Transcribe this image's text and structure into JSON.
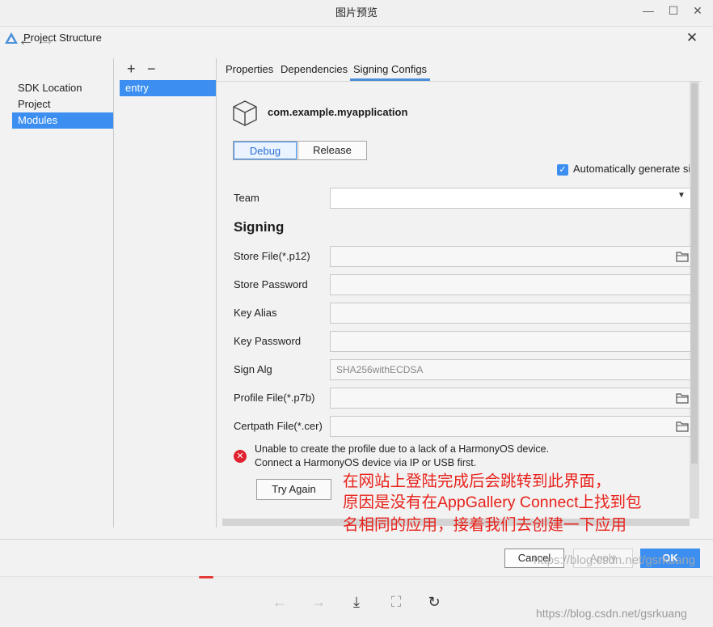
{
  "viewer": {
    "title": "图片预览",
    "controls": {
      "minimize": "—",
      "maximize": "☐",
      "close": "✕"
    },
    "toolbar": {
      "prev": "←",
      "next": "→",
      "download": "⤓",
      "fit": "⛶",
      "rotate": "↻"
    },
    "watermark": "https://blog.csdn.net/gsrkuang"
  },
  "dialog": {
    "title": "Project Structure",
    "close": "✕",
    "nav": {
      "back": "←",
      "forward": "→",
      "items": [
        "SDK Location",
        "Project",
        "Modules"
      ],
      "selected": "Modules"
    },
    "modules": {
      "add": "+",
      "remove": "−",
      "items": [
        "entry"
      ]
    },
    "tabs": [
      "Properties",
      "Dependencies",
      "Signing Configs"
    ],
    "active_tab": "Signing Configs",
    "module_name": "com.example.myapplication",
    "build_types": [
      "Debug",
      "Release"
    ],
    "selected_build_type": "Debug",
    "auto_generate": {
      "label": "Automatically generate si",
      "checked": true
    },
    "team": {
      "label": "Team",
      "value": ""
    },
    "signing_heading": "Signing",
    "fields": {
      "store_file": {
        "label": "Store File(*.p12)",
        "value": ""
      },
      "store_password": {
        "label": "Store Password",
        "value": ""
      },
      "key_alias": {
        "label": "Key Alias",
        "value": ""
      },
      "key_password": {
        "label": "Key Password",
        "value": ""
      },
      "sign_alg": {
        "label": "Sign Alg",
        "value": "SHA256withECDSA"
      },
      "profile_file": {
        "label": "Profile File(*.p7b)",
        "value": ""
      },
      "certpath_file": {
        "label": "Certpath File(*.cer)",
        "value": ""
      }
    },
    "error": {
      "line1": "Unable to create the profile due to a lack of a HarmonyOS device.",
      "line2": "Connect a HarmonyOS device via IP or USB first.",
      "retry": "Try Again"
    },
    "buttons": {
      "cancel": "Cancel",
      "apply": "Apply",
      "ok": "OK"
    },
    "watermark": "https://blog.csdn.net/gsrkuang"
  },
  "annotation": {
    "line1": "在网站上登陆完成后会跳转到此界面，",
    "line2": "原因是没有在AppGallery Connect上找到包",
    "line3": "名相同的应用，接着我们去创建一下应用"
  },
  "colors": {
    "accent": "#3c8ff0",
    "error": "#e0222f",
    "annotation": "#e8221b"
  }
}
